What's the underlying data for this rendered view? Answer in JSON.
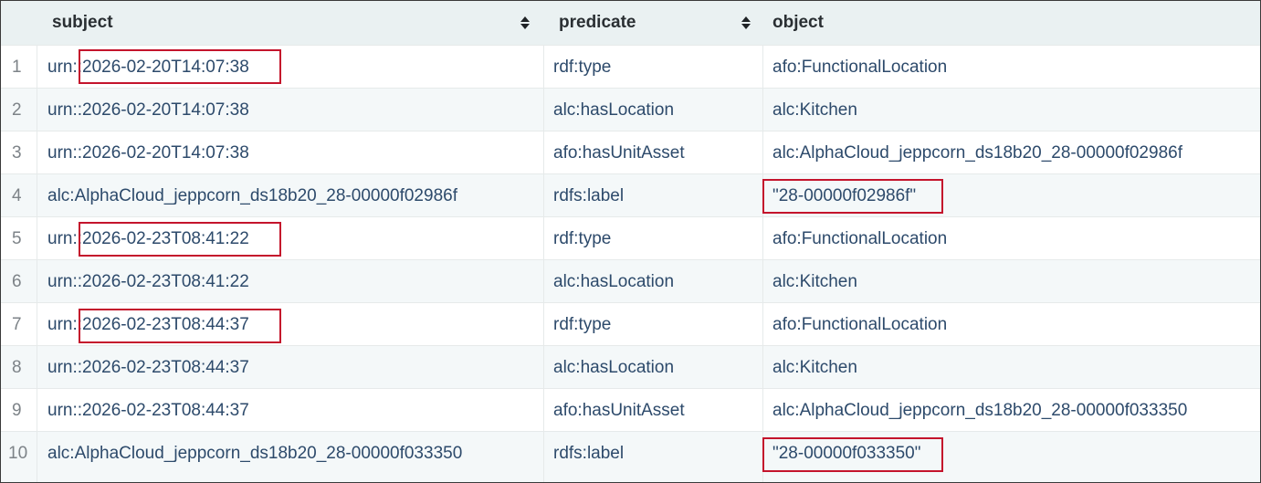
{
  "columns": [
    {
      "label": "subject"
    },
    {
      "label": "predicate"
    },
    {
      "label": "object"
    }
  ],
  "rows": [
    {
      "idx": "1",
      "subject": "urn::2026-02-20T14:07:38",
      "predicate": "rdf:type",
      "object": "afo:FunctionalLocation"
    },
    {
      "idx": "2",
      "subject": "urn::2026-02-20T14:07:38",
      "predicate": "alc:hasLocation",
      "object": "alc:Kitchen"
    },
    {
      "idx": "3",
      "subject": "urn::2026-02-20T14:07:38",
      "predicate": "afo:hasUnitAsset",
      "object": "alc:AlphaCloud_jeppcorn_ds18b20_28-00000f02986f"
    },
    {
      "idx": "4",
      "subject": "alc:AlphaCloud_jeppcorn_ds18b20_28-00000f02986f",
      "predicate": "rdfs:label",
      "object": "\"28-00000f02986f\""
    },
    {
      "idx": "5",
      "subject": "urn::2026-02-23T08:41:22",
      "predicate": "rdf:type",
      "object": "afo:FunctionalLocation"
    },
    {
      "idx": "6",
      "subject": "urn::2026-02-23T08:41:22",
      "predicate": "alc:hasLocation",
      "object": "alc:Kitchen"
    },
    {
      "idx": "7",
      "subject": "urn::2026-02-23T08:44:37",
      "predicate": "rdf:type",
      "object": "afo:FunctionalLocation"
    },
    {
      "idx": "8",
      "subject": "urn::2026-02-23T08:44:37",
      "predicate": "alc:hasLocation",
      "object": "alc:Kitchen"
    },
    {
      "idx": "9",
      "subject": "urn::2026-02-23T08:44:37",
      "predicate": "afo:hasUnitAsset",
      "object": "alc:AlphaCloud_jeppcorn_ds18b20_28-00000f033350"
    },
    {
      "idx": "10",
      "subject": "alc:AlphaCloud_jeppcorn_ds18b20_28-00000f033350",
      "predicate": "rdfs:label",
      "object": "\"28-00000f033350\""
    }
  ],
  "icons": {
    "sort": "sort-up-down-icon"
  },
  "colors": {
    "header_bg": "#eaf1f2",
    "row_alt_bg": "#f4f8f9",
    "link_text": "#2d4a6b",
    "highlight": "#c4142c"
  }
}
